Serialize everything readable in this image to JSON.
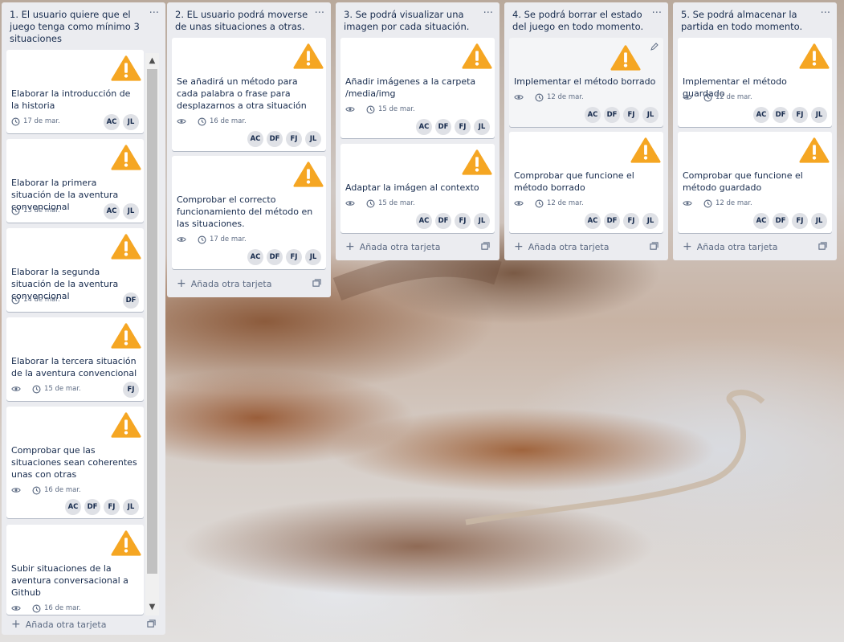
{
  "lists": [
    {
      "title": "1. El usuario quiere que el juego tenga como mínimo 3 situaciones",
      "menu": "···",
      "add_label": "Añada otra tarjeta",
      "cards": [
        {
          "title": "Elaborar la introducción de la historia",
          "date": "17 de mar.",
          "members": [
            "AC",
            "JL"
          ]
        },
        {
          "title": "Elaborar la primera situación de la aventura convencional",
          "date": "13 de mar.",
          "members": [
            "AC",
            "JL"
          ]
        },
        {
          "title": "Elaborar la segunda situación de la aventura convencional",
          "date": "14 de mar.",
          "members": [
            "DF"
          ]
        },
        {
          "title": "Elaborar la tercera situación de la aventura convencional",
          "date": "15 de mar.",
          "members": [
            "FJ"
          ]
        },
        {
          "title": "Comprobar que las situaciones sean coherentes unas con otras",
          "date": "16 de mar.",
          "members": [
            "AC",
            "DF",
            "FJ",
            "JL"
          ]
        },
        {
          "title": "Subir situaciones de la aventura conversacional a Github",
          "date": "16 de mar.",
          "members": []
        }
      ]
    },
    {
      "title": "2. EL usuario podrá moverse de unas situaciones a otras.",
      "menu": "···",
      "add_label": "Añada otra tarjeta",
      "cards": [
        {
          "title": "Se añadirá un método para cada palabra o frase para desplazarnos a otra situación",
          "date": "16 de mar.",
          "members": [
            "AC",
            "DF",
            "FJ",
            "JL"
          ]
        },
        {
          "title": "Comprobar el correcto funcionamiento del método en las situaciones.",
          "date": "17 de mar.",
          "members": [
            "AC",
            "DF",
            "FJ",
            "JL"
          ]
        }
      ]
    },
    {
      "title": "3. Se podrá visualizar una imagen por cada situación.",
      "menu": "···",
      "add_label": "Añada otra tarjeta",
      "cards": [
        {
          "title": "Añadir imágenes a la carpeta /media/img",
          "date": "15 de mar.",
          "members": [
            "AC",
            "DF",
            "FJ",
            "JL"
          ]
        },
        {
          "title": "Adaptar la imágen al contexto",
          "date": "15 de mar.",
          "members": [
            "AC",
            "DF",
            "FJ",
            "JL"
          ]
        }
      ]
    },
    {
      "title": "4. Se podrá borrar el estado del juego en todo momento.",
      "menu": "···",
      "add_label": "Añada otra tarjeta",
      "cards": [
        {
          "title": "Implementar el método borrado",
          "date": "12 de mar.",
          "members": [
            "AC",
            "DF",
            "FJ",
            "JL"
          ]
        },
        {
          "title": "Comprobar que funcione el método borrado",
          "date": "12 de mar.",
          "members": [
            "AC",
            "DF",
            "FJ",
            "JL"
          ]
        }
      ]
    },
    {
      "title": "5. Se podrá almacenar la partida en todo momento.",
      "menu": "···",
      "add_label": "Añada otra tarjeta",
      "cards": [
        {
          "title": "Implementar el método guardado",
          "date": "12 de mar.",
          "members": [
            "AC",
            "DF",
            "FJ",
            "JL"
          ]
        },
        {
          "title": "Comprobar que funcione el método guardado",
          "date": "12 de mar.",
          "members": [
            "AC",
            "DF",
            "FJ",
            "JL"
          ]
        }
      ]
    }
  ],
  "colors": {
    "warning": "#f5a623",
    "list_bg": "#ebecf0",
    "avatar_bg": "#dfe1e6"
  },
  "icons": {
    "card_badge": "warning-icon",
    "watch": "eye-icon",
    "due": "clock-icon",
    "add": "plus-icon",
    "template": "card-template-icon",
    "edit": "pencil-icon"
  }
}
